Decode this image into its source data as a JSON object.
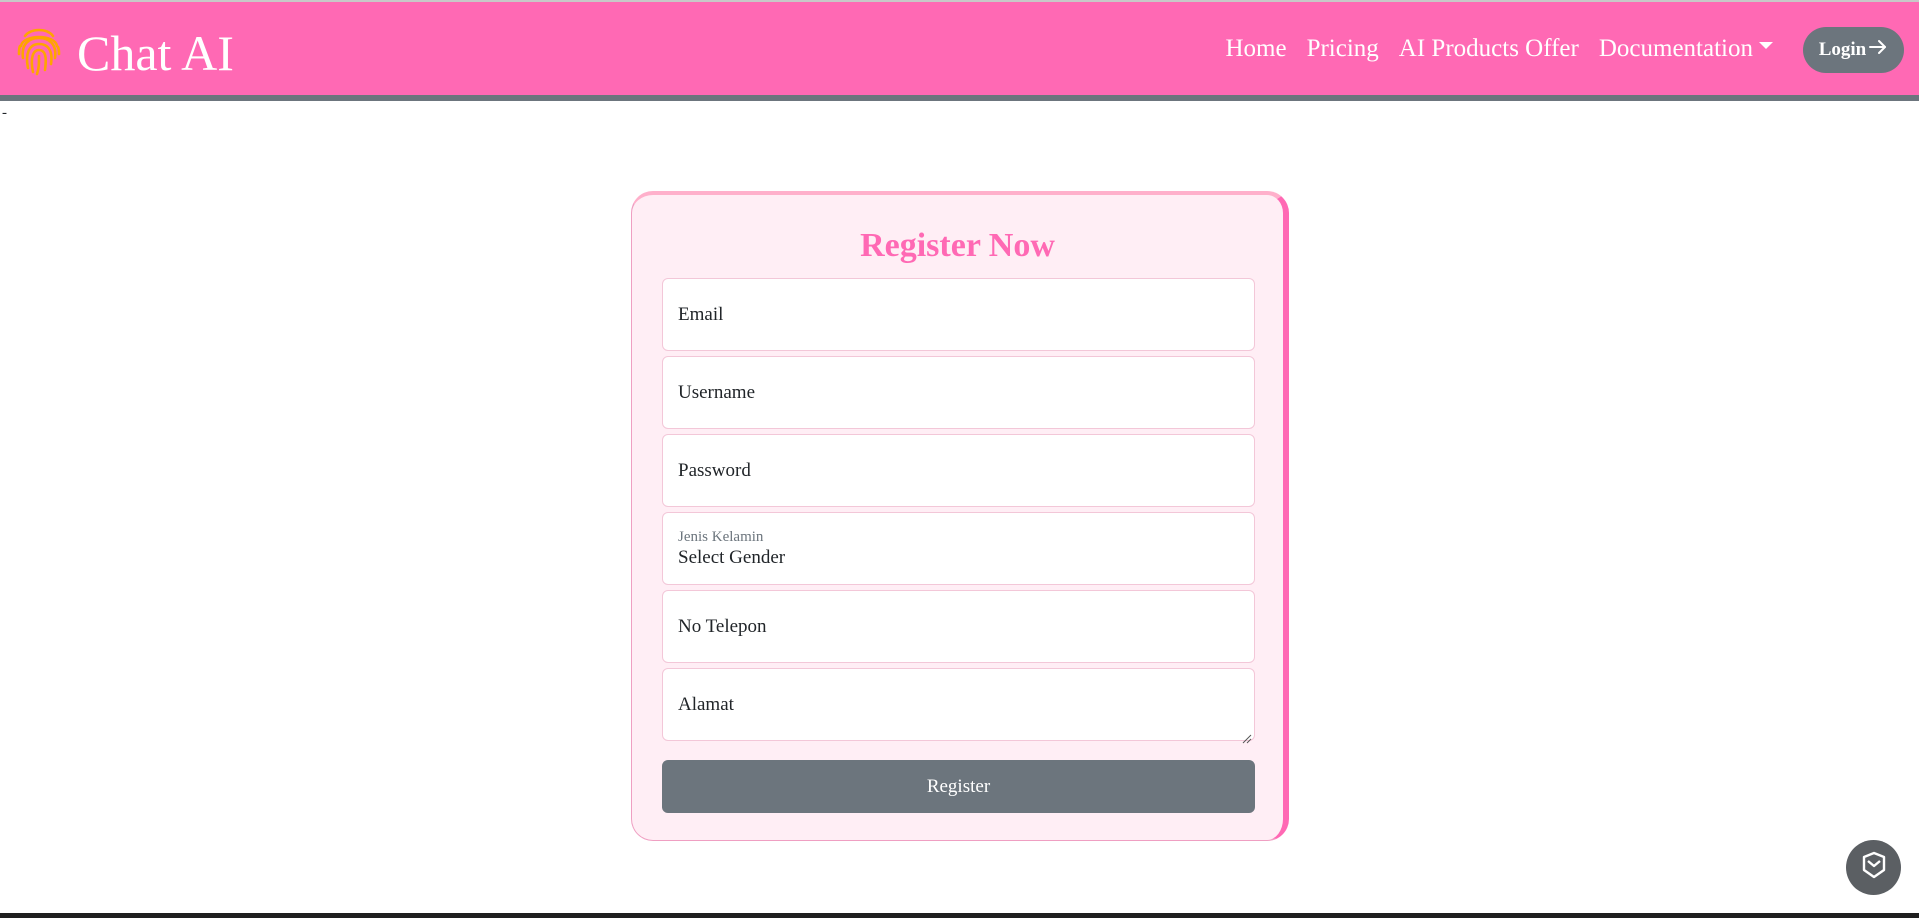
{
  "header": {
    "brand": "Chat AI",
    "logo_icon": "fingerprint-icon",
    "nav": [
      {
        "label": "Home"
      },
      {
        "label": "Pricing"
      },
      {
        "label": "AI Products Offer"
      },
      {
        "label": "Documentation"
      }
    ],
    "login_label": "Login",
    "colors": {
      "navbar_bg": "#ff69b4",
      "navbar_border": "#6c757d",
      "logo": "#ffa500"
    }
  },
  "page": {
    "stray_text": "-"
  },
  "form": {
    "title": "Register Now",
    "fields": {
      "email": "Email",
      "username": "Username",
      "password": "Password",
      "gender_label": "Jenis Kelamin",
      "gender_value": "Select Gender",
      "phone": "No Telepon",
      "address": "Alamat"
    },
    "submit_label": "Register",
    "colors": {
      "card_bg": "#ffeef5",
      "title": "#ff69b4",
      "button": "#6c757d"
    }
  },
  "widgets": {
    "fab_icon": "shield-icon"
  }
}
